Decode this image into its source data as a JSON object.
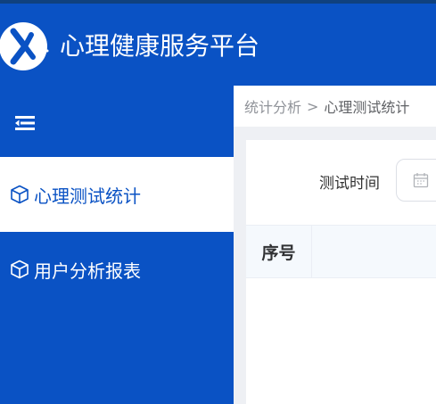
{
  "header": {
    "title": "心理健康服务平台",
    "logo_icon": "yk-logo-icon"
  },
  "sidebar": {
    "toggle_icon": "menu-fold-icon",
    "items": [
      {
        "label": "心理测试统计",
        "icon": "cube-icon",
        "active": true
      },
      {
        "label": "用户分析报表",
        "icon": "cube-icon",
        "active": false
      }
    ]
  },
  "breadcrumb": {
    "items": [
      "统计分析",
      "心理测试统计"
    ],
    "separator": ">"
  },
  "filter": {
    "test_time_label": "测试时间",
    "date_icon": "calendar-icon"
  },
  "table": {
    "columns": [
      "序号"
    ],
    "rows": []
  },
  "colors": {
    "brand_blue": "#0a52c4",
    "top_strip": "#10417e",
    "page_bg": "#eef0f4"
  }
}
